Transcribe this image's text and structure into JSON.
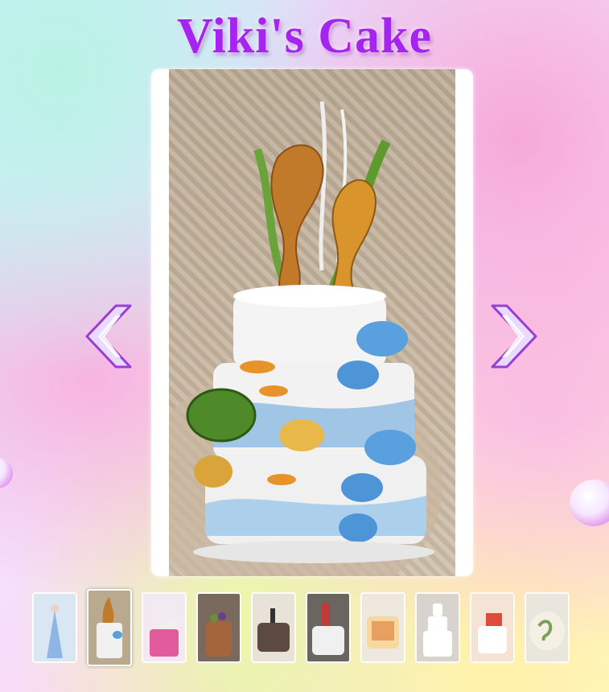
{
  "app": {
    "title": "Viki's Cake"
  },
  "viewer": {
    "prev_icon": "chevron-left-icon",
    "next_icon": "chevron-right-icon",
    "current_index": 2,
    "image_description_icon": "cake-photo"
  },
  "thumbnails": [
    {
      "icon": "cake-thumbnail",
      "bg": "#d9e7f2",
      "cake": "#8fb5e6"
    },
    {
      "icon": "cake-thumbnail",
      "bg": "#b9a98f",
      "cake": "#f1f1f1"
    },
    {
      "icon": "cake-thumbnail",
      "bg": "#f3e9f0",
      "cake": "#e25b9c"
    },
    {
      "icon": "cake-thumbnail",
      "bg": "#7a6a5e",
      "cake": "#a3653b"
    },
    {
      "icon": "cake-thumbnail",
      "bg": "#e8e2d8",
      "cake": "#5c4a40"
    },
    {
      "icon": "cake-thumbnail",
      "bg": "#6b6560",
      "cake": "#f0f0f0"
    },
    {
      "icon": "cake-thumbnail",
      "bg": "#efe8df",
      "cake": "#f7d9a0"
    },
    {
      "icon": "cake-thumbnail",
      "bg": "#d8d3cc",
      "cake": "#ffffff"
    },
    {
      "icon": "cake-thumbnail",
      "bg": "#f5e3d5",
      "cake": "#e04a3a"
    },
    {
      "icon": "cake-thumbnail",
      "bg": "#e9e6dd",
      "cake": "#7aa05a"
    }
  ],
  "colors": {
    "title": "#a624f0",
    "arrow_fill": "#e9dbff",
    "arrow_stroke": "#9b3cd6"
  }
}
